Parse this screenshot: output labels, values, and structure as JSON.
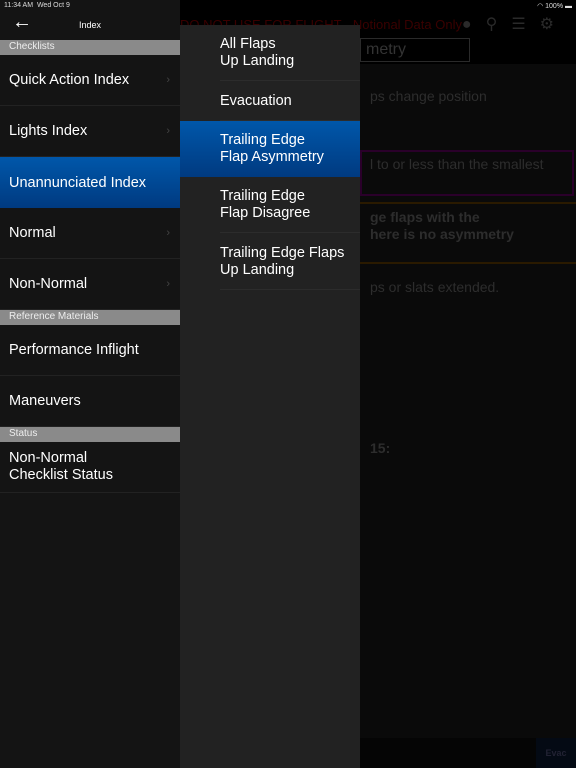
{
  "status": {
    "time": "11:34 AM",
    "date": "Wed Oct 9",
    "battery": "100%"
  },
  "background": {
    "warning": "DO NOT USE FOR FLIGHT - Notional Data Only",
    "title_fragment": "metry",
    "lines": [
      "ps change position",
      "l to or less than the smallest",
      "ge flaps with the",
      "here is no asymmetry",
      "ps or slats extended.",
      "15:"
    ],
    "evac_button": "Evac"
  },
  "index": {
    "title": "Index",
    "sections": [
      {
        "header": "Checklists",
        "items": [
          {
            "label": "Quick Action Index",
            "chevron": true
          },
          {
            "label": "Lights Index",
            "chevron": true
          },
          {
            "label": "Unannunciated Index",
            "selected": true
          },
          {
            "label": "Normal",
            "chevron": true
          },
          {
            "label": "Non-Normal",
            "chevron": true
          }
        ]
      },
      {
        "header": "Reference Materials",
        "items": [
          {
            "label": "Performance Inflight"
          },
          {
            "label": "Maneuvers"
          }
        ]
      },
      {
        "header": "Status",
        "items": [
          {
            "label": "Non-Normal\nChecklist Status"
          }
        ]
      }
    ]
  },
  "submenu": {
    "items": [
      {
        "label": "All Flaps\nUp Landing"
      },
      {
        "label": "Evacuation"
      },
      {
        "label": "Trailing Edge\nFlap Asymmetry",
        "selected": true
      },
      {
        "label": "Trailing Edge\nFlap Disagree"
      },
      {
        "label": "Trailing Edge Flaps\nUp Landing"
      }
    ]
  },
  "colors": {
    "selected": "#0057aa",
    "section_header": "#8a8a8a"
  }
}
